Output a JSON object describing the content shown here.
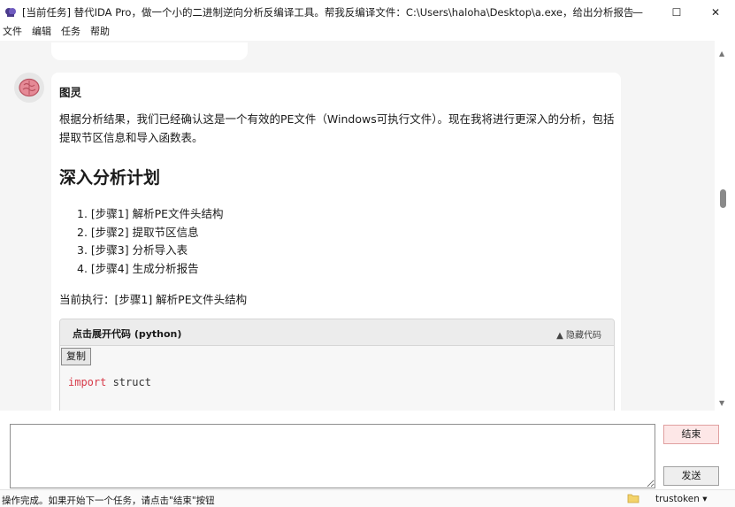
{
  "window": {
    "title": "[当前任务] 替代IDA Pro，做一个小的二进制逆向分析反编译工具。帮我反编译文件：C:\\Users\\haloha\\Desktop\\a.exe，给出分析报告",
    "minimize_glyph": "—",
    "maximize_glyph": "☐",
    "close_glyph": "✕"
  },
  "menu": [
    "文件",
    "编辑",
    "任务",
    "帮助"
  ],
  "message": {
    "sender": "图灵",
    "intro": "根据分析结果，我们已经确认这是一个有效的PE文件（Windows可执行文件）。现在我将进行更深入的分析，包括提取节区信息和导入函数表。",
    "heading": "深入分析计划",
    "steps": [
      "1. [步骤1] 解析PE文件头结构",
      "2. [步骤2] 提取节区信息",
      "3. [步骤3] 分析导入表",
      "4. [步骤4] 生成分析报告"
    ],
    "current": "当前执行：[步骤1] 解析PE文件头结构",
    "code": {
      "title": "点击展开代码 (python)",
      "hide_label": "▲ 隐藏代码",
      "copy_label": "复制",
      "keyword": "import",
      "module": " struct"
    }
  },
  "input": {
    "value": ""
  },
  "buttons": {
    "end": "结束",
    "send": "发送"
  },
  "status": {
    "text": "操作完成。如果开始下一个任务，请点击\"结束\"按钮",
    "token": "trustoken ▾"
  },
  "scrollbar": {
    "up": "▲",
    "down": "▼"
  },
  "colors": {
    "end_button_bg": "#fde7e7",
    "keyword": "#d73a49",
    "chat_bg": "#f5f5f5"
  },
  "icons": {
    "app": "brain-icon",
    "avatar": "brain-icon",
    "folder": "folder-icon"
  }
}
